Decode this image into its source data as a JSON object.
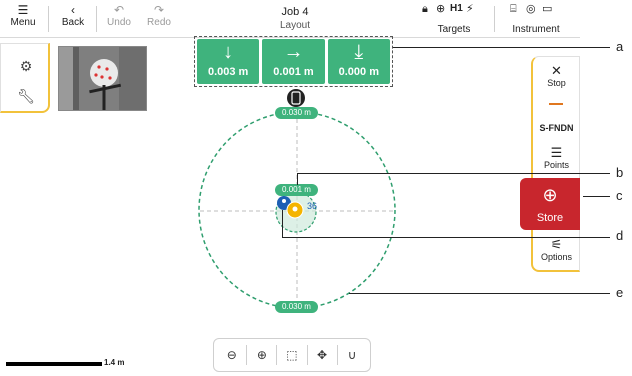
{
  "topbar": {
    "menu": {
      "icon": "menu-icon",
      "label": "Menu"
    },
    "back": {
      "icon": "chevron-left-icon",
      "label": "Back"
    },
    "undo": {
      "icon": "undo-icon",
      "label": "Undo"
    },
    "redo": {
      "icon": "redo-icon",
      "label": "Redo"
    },
    "job_title": "Job 4",
    "job_subtitle": "Layout",
    "targets": {
      "label": "Targets",
      "height_label": "H1"
    },
    "instrument": {
      "label": "Instrument"
    }
  },
  "left_panel": {
    "items": [
      {
        "icon": "view-settings-icon"
      },
      {
        "icon": "wrench-icon"
      }
    ]
  },
  "deltas": [
    {
      "icon": "arrow-down-icon",
      "value": "0.003 m"
    },
    {
      "icon": "arrow-right-icon",
      "value": "0.001 m"
    },
    {
      "icon": "height-down-icon",
      "value": "0.000 m"
    }
  ],
  "right_panel": {
    "stop_label": "Stop",
    "code_label": "S-FNDN",
    "points_label": "Points",
    "options_label": "Options"
  },
  "store": {
    "label": "Store"
  },
  "plot": {
    "outer_tolerance_top": "0.030 m",
    "outer_tolerance_bottom": "0.030 m",
    "inner_tolerance": "0.001 m",
    "point_number": "36"
  },
  "map_tools": [
    "zoom-out-icon",
    "zoom-in-icon",
    "zoom-window-icon",
    "pan-icon",
    "magnet-icon"
  ],
  "scale": {
    "label": "1.4 m"
  },
  "callouts": [
    "a",
    "b",
    "c",
    "d",
    "e"
  ],
  "colors": {
    "accent_green": "#3fb37d",
    "store_red": "#c8262d",
    "panel_yellow": "#f2c23b",
    "tolerance_green": "#2f9e6e"
  }
}
